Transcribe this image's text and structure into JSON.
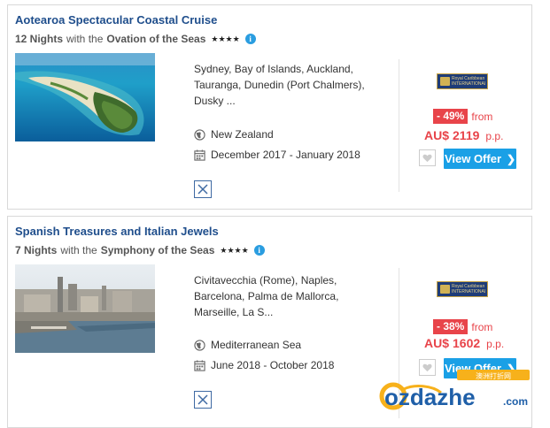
{
  "cruises": [
    {
      "title": "Aotearoa Spectacular Coastal Cruise",
      "nights": "12 Nights",
      "with_text": "with the",
      "ship": "Ovation of the Seas",
      "stars": "★★★★",
      "info_icon": "i",
      "ports": "Sydney, Bay of Islands, Auckland, Tauranga, Dunedin (Port Chalmers), Dusky ...",
      "region": "New Zealand",
      "dates": "December 2017 - January 2018",
      "discount": "- 49%",
      "from_label": "from",
      "currency": "AU$",
      "price": "2119",
      "per": "p.p.",
      "button": "View Offer",
      "logo_text": "Royal Caribbean INTERNATIONAL"
    },
    {
      "title": "Spanish Treasures and Italian Jewels",
      "nights": "7 Nights",
      "with_text": "with the",
      "ship": "Symphony of the Seas",
      "stars": "★★★★",
      "info_icon": "i",
      "ports": "Civitavecchia (Rome), Naples, Barcelona, Palma de Mallorca, Marseille, La S...",
      "region": "Mediterranean Sea",
      "dates": "June 2018 - October 2018",
      "discount": "- 38%",
      "from_label": "from",
      "currency": "AU$",
      "price": "1602",
      "per": "p.p.",
      "button": "View Offer",
      "logo_text": "Royal Caribbean INTERNATIONAL"
    }
  ],
  "watermark": {
    "brand": "ozdazhe",
    "suffix": ".com",
    "tagline": "澳洲打折网"
  },
  "colors": {
    "title": "#1f4e8c",
    "price": "#e8444a",
    "button": "#1aa0e6",
    "info": "#2a9de0"
  }
}
